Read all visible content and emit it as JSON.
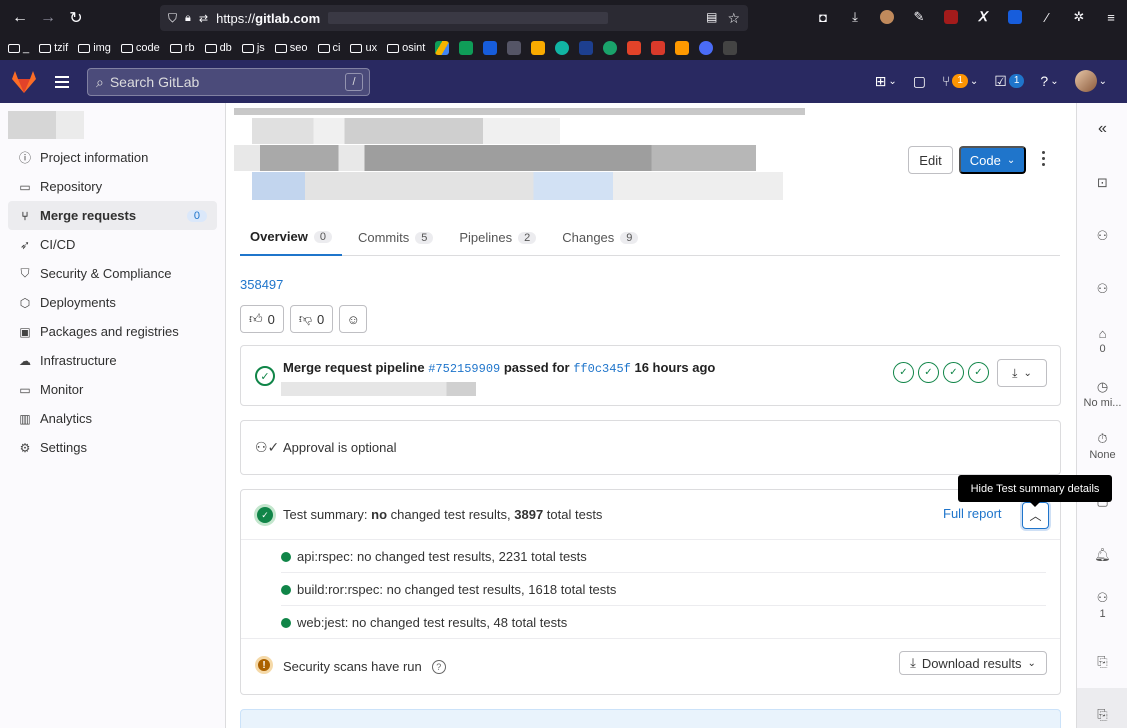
{
  "browser": {
    "url_prefix": "https://",
    "url_domain": "gitlab.com",
    "bookmarks": [
      "_",
      "tzif",
      "img",
      "code",
      "rb",
      "db",
      "js",
      "seo",
      "ci",
      "ux",
      "osint"
    ]
  },
  "topbar": {
    "search_placeholder": "Search GitLab",
    "search_shortcut": "/",
    "mr_count": "1",
    "todo_count": "1"
  },
  "sidebar": {
    "items": [
      {
        "label": "Project information",
        "icon": "info-icon"
      },
      {
        "label": "Repository",
        "icon": "doc-icon"
      },
      {
        "label": "Merge requests",
        "icon": "merge-request-icon",
        "count": "0"
      },
      {
        "label": "CI/CD",
        "icon": "rocket-icon"
      },
      {
        "label": "Security & Compliance",
        "icon": "shield-icon"
      },
      {
        "label": "Deployments",
        "icon": "deploy-icon"
      },
      {
        "label": "Packages and registries",
        "icon": "package-icon"
      },
      {
        "label": "Infrastructure",
        "icon": "cloud-icon"
      },
      {
        "label": "Monitor",
        "icon": "monitor-icon"
      },
      {
        "label": "Analytics",
        "icon": "chart-icon"
      },
      {
        "label": "Settings",
        "icon": "gear-icon"
      }
    ]
  },
  "header": {
    "edit_label": "Edit",
    "code_label": "Code"
  },
  "tabs": [
    {
      "label": "Overview",
      "count": "0"
    },
    {
      "label": "Commits",
      "count": "5"
    },
    {
      "label": "Pipelines",
      "count": "2"
    },
    {
      "label": "Changes",
      "count": "9"
    }
  ],
  "mr": {
    "link": "358497",
    "thumbs_up": "0",
    "thumbs_down": "0"
  },
  "pipeline": {
    "text1": "Merge request pipeline",
    "pipeline_id": "#752159909",
    "text2": "passed for",
    "commit": "ff0c345f",
    "text3": "16 hours ago"
  },
  "approval": {
    "text": "Approval is optional"
  },
  "tests": {
    "summary_prefix": "Test summary:",
    "summary_no": "no",
    "summary_mid": "changed test results,",
    "summary_total": "3897",
    "summary_suffix": "total tests",
    "full_report": "Full report",
    "rows": [
      "api:rspec: no changed test results, 2231 total tests",
      "build:ror:rspec: no changed test results, 1618 total tests",
      "web:jest: no changed test results, 48 total tests"
    ]
  },
  "security": {
    "text": "Security scans have run",
    "download_label": "Download results"
  },
  "tooltip": "Hide Test summary details",
  "right_sidebar": {
    "labels_count": "0",
    "milestone": "No mi...",
    "time_tracking": "None",
    "participants_count": "1"
  },
  "colors": {
    "gl_nav": "#292961",
    "primary": "#1f75cb",
    "success": "#108548",
    "warning": "#ab6100"
  }
}
